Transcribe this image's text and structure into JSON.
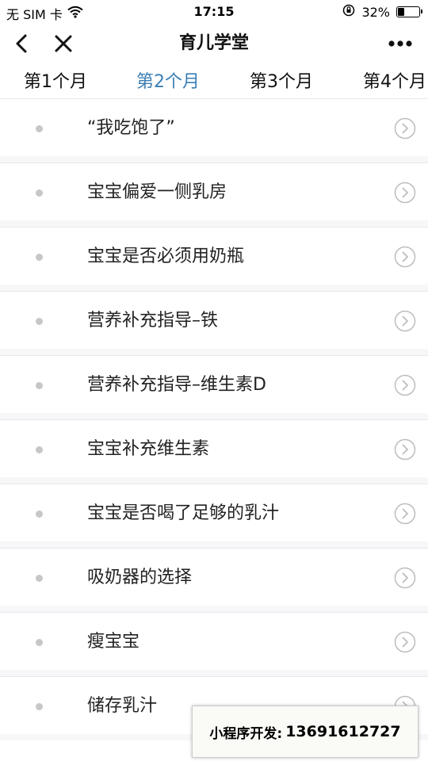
{
  "status_bar": {
    "carrier": "无 SIM 卡",
    "time": "17:15",
    "battery_percent": "32%",
    "battery_level": 0.32
  },
  "nav": {
    "title": "育儿学堂"
  },
  "tabs": [
    {
      "label": "第1个月",
      "active": false
    },
    {
      "label": "第2个月",
      "active": true
    },
    {
      "label": "第3个月",
      "active": false
    },
    {
      "label": "第4个月",
      "active": false
    }
  ],
  "articles": [
    {
      "title": "“我吃饱了”"
    },
    {
      "title": "宝宝偏爱一侧乳房"
    },
    {
      "title": "宝宝是否必须用奶瓶"
    },
    {
      "title": "营养补充指导–铁"
    },
    {
      "title": "营养补充指导–维生素D"
    },
    {
      "title": "宝宝补充维生素"
    },
    {
      "title": "宝宝是否喝了足够的乳汁"
    },
    {
      "title": "吸奶器的选择"
    },
    {
      "title": "瘦宝宝"
    },
    {
      "title": "储存乳汁"
    }
  ],
  "promo": {
    "label": "小程序开发:",
    "phone": "13691612727"
  },
  "colors": {
    "accent": "#3b7fb4",
    "bullet": "#c7c7c7",
    "chevron": "#bdbdbd",
    "divider": "#e8e8ec"
  },
  "icons": {
    "back": "chevron-left-icon",
    "close": "close-icon",
    "more": "more-dots-icon",
    "item": "chevron-right-circle-icon"
  }
}
